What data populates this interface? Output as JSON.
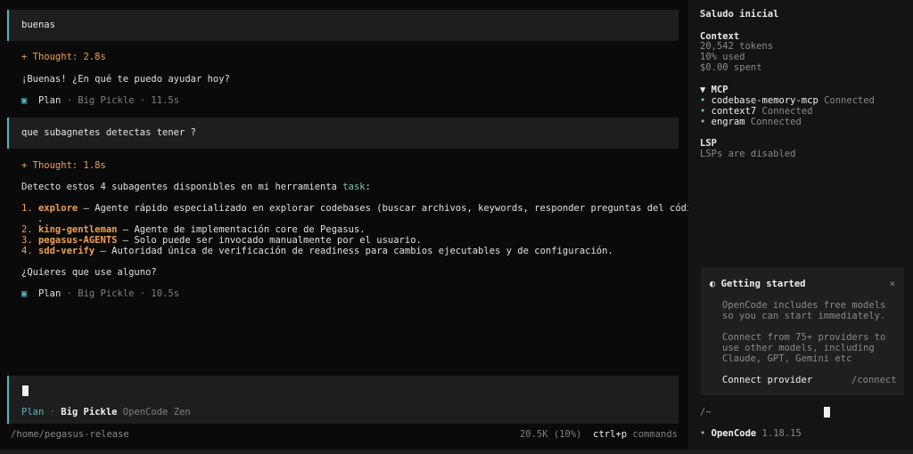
{
  "conversation": {
    "msg1": "buenas",
    "thought1": "+ Thought: 2.8s",
    "reply1": "¡Buenas! ¿En qué te puedo ayudar hoy?",
    "meta1": {
      "icon": "▣",
      "mode": "Plan",
      "sep": " · ",
      "model": "Big Pickle",
      "time": " · 11.5s"
    },
    "msg2": "que subagnetes detectas tener ?",
    "thought2": "+ Thought: 1.8s",
    "reply2_prefix": "Detecto estos 4 subagentes disponibles en mi herramienta ",
    "reply2_code": "task",
    "reply2_suffix": ":",
    "agents": [
      {
        "num": "1. ",
        "name": "explore",
        "desc": " — Agente rápido especializado en explorar codebases (buscar archivos, keywords, responder preguntas del código)"
      },
      {
        "num": "2. ",
        "name": "king-gentleman",
        "desc": " — Agente de implementación core de Pegasus."
      },
      {
        "num": "3. ",
        "name": "pegasus-AGENTS",
        "desc": " — Solo puede ser invocado manualmente por el usuario."
      },
      {
        "num": "4. ",
        "name": "sdd-verify",
        "desc": " — Autoridad única de verificación de readiness para cambios ejecutables y de configuración."
      }
    ],
    "wrap_dot": ".",
    "question": "¿Quieres que use alguno?",
    "meta2": {
      "icon": "▣",
      "mode": "Plan",
      "sep": " · ",
      "model": "Big Pickle",
      "time": " · 10.5s"
    }
  },
  "input": {
    "mode": "Plan",
    "sep": " · ",
    "model": "Big Pickle",
    "provider": " OpenCode Zen"
  },
  "status": {
    "path": "/home/pegasus-release",
    "tokens": "20.5K (10%)",
    "shortcut": "ctrl+p",
    "shortcut_label": " commands"
  },
  "sidebar": {
    "title": "Saludo inicial",
    "context_title": "Context",
    "tokens": "20,542 tokens",
    "used": "10% used",
    "spent": "$0.00 spent",
    "mcp_title": "▼ MCP",
    "mcp": [
      {
        "dot": "•",
        "name": "codebase-memory-mcp",
        "status": " Connected"
      },
      {
        "dot": "•",
        "name": "context7",
        "status": " Connected"
      },
      {
        "dot": "•",
        "name": "engram",
        "status": " Connected"
      }
    ],
    "lsp_title": "LSP",
    "lsp_status": "LSPs are disabled",
    "getting_started": {
      "icon": "◐",
      "title": "Getting started",
      "close": "×",
      "lines1": [
        "OpenCode includes free models",
        "so you can start immediately."
      ],
      "lines2": [
        "Connect from 75+ providers to",
        "use other models, including",
        "Claude, GPT, Gemini etc"
      ],
      "connect": "Connect provider",
      "command": "/connect"
    },
    "cwd": "/~",
    "app_dot": "•",
    "app_name": "OpenCode",
    "version": " 1.18.15"
  },
  "colors": {
    "accent": "#56b6c2",
    "thought": "#f0a050",
    "code": "#7ec699"
  }
}
